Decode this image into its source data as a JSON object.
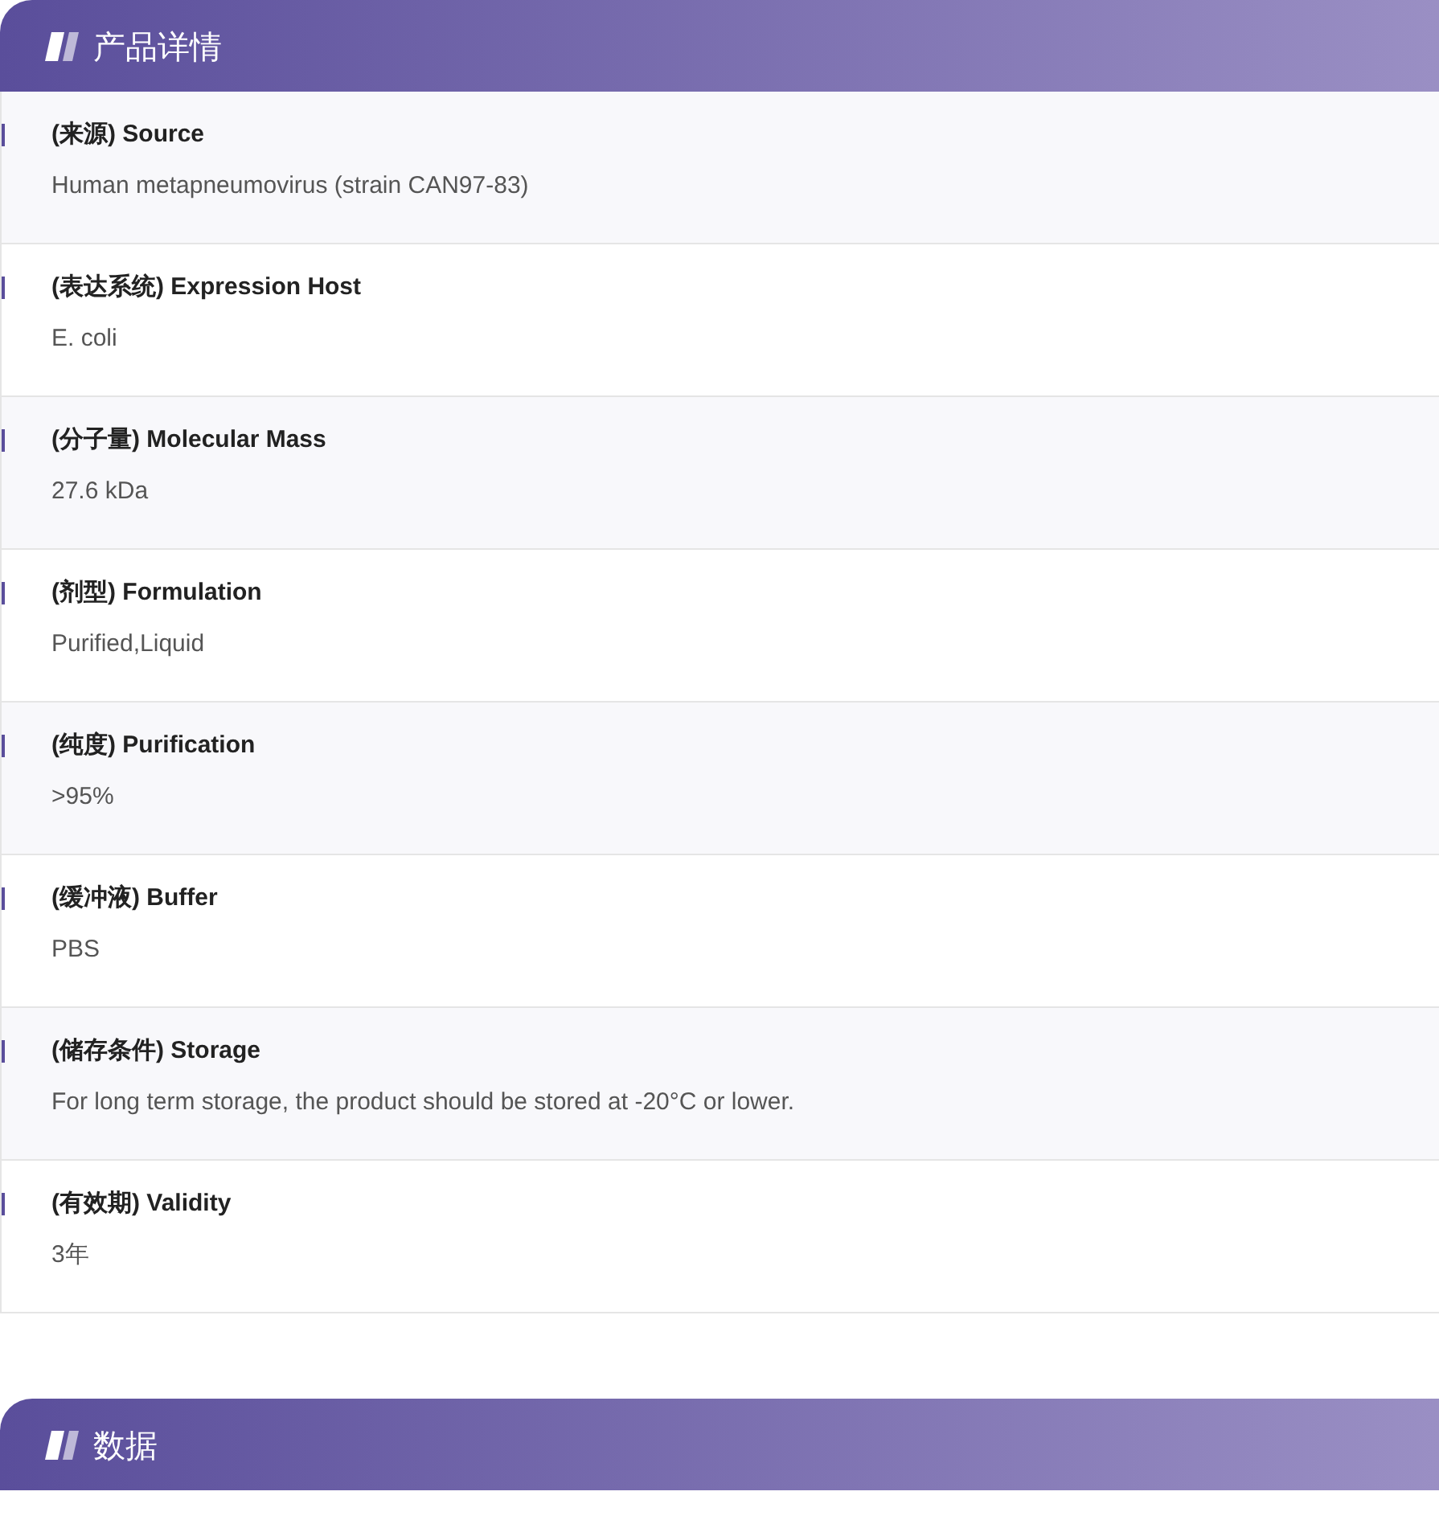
{
  "sections": [
    {
      "title": "产品详情",
      "rows": [
        {
          "label": "(来源) Source",
          "value": "Human metapneumovirus (strain CAN97-83)"
        },
        {
          "label": "(表达系统) Expression Host",
          "value": "E. coli"
        },
        {
          "label": "(分子量) Molecular Mass",
          "value": "27.6 kDa"
        },
        {
          "label": "(剂型) Formulation",
          "value": "Purified,Liquid"
        },
        {
          "label": "(纯度) Purification",
          "value": ">95%"
        },
        {
          "label": "(缓冲液) Buffer",
          "value": "PBS"
        },
        {
          "label": "(储存条件) Storage",
          "value": "For long term storage, the product should be stored at -20°C or lower."
        },
        {
          "label": "(有效期) Validity",
          "value": "3年"
        }
      ]
    },
    {
      "title": "数据"
    }
  ]
}
